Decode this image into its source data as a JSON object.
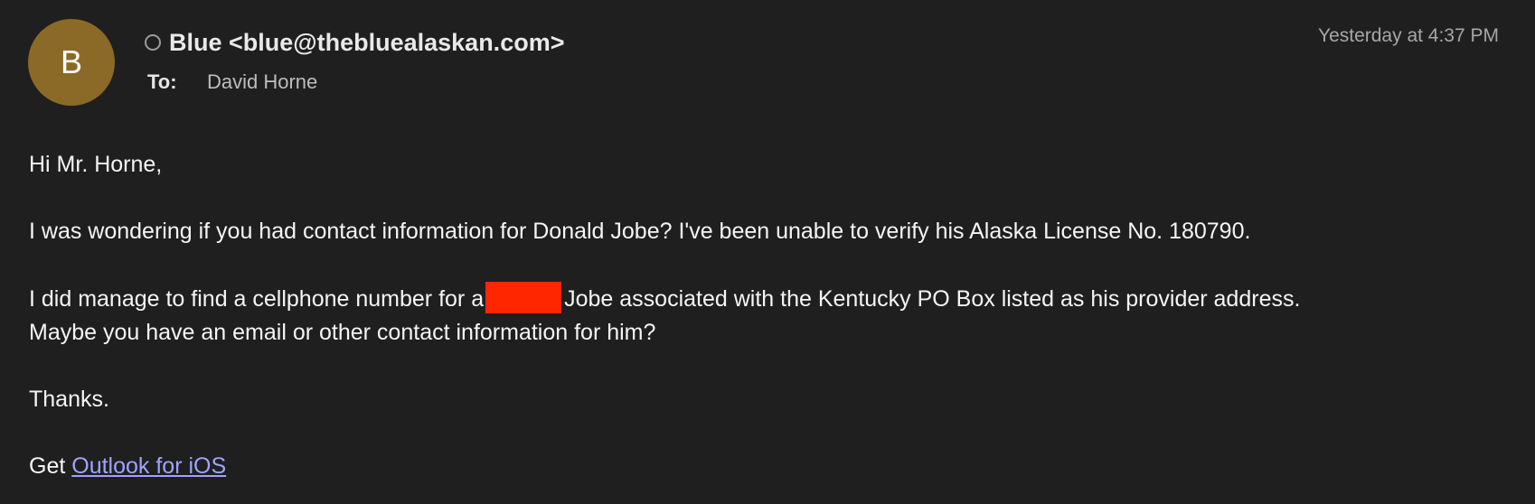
{
  "header": {
    "avatar_initial": "B",
    "avatar_color": "#8a6a26",
    "status_icon": "circle-outline-icon",
    "sender": "Blue <blue@thebluealaskan.com>",
    "to_label": "To:",
    "to_value": "David Horne",
    "timestamp": "Yesterday at 4:37 PM"
  },
  "body": {
    "greeting": "Hi Mr. Horne,",
    "paragraph1": "I was wondering if you had contact information for Donald Jobe? I've been unable to verify his Alaska License No. 180790.",
    "paragraph2_before": "I did manage to find a cellphone number for a",
    "paragraph2_after": "Jobe associated with the Kentucky PO Box listed as his provider address.",
    "paragraph2_line2": "Maybe you have an email or other contact information for him?",
    "redaction_color": "#ff2600",
    "thanks": "Thanks.",
    "signature_prefix": "Get",
    "signature_link": "Outlook for iOS",
    "link_color": "#9fa3ff"
  }
}
